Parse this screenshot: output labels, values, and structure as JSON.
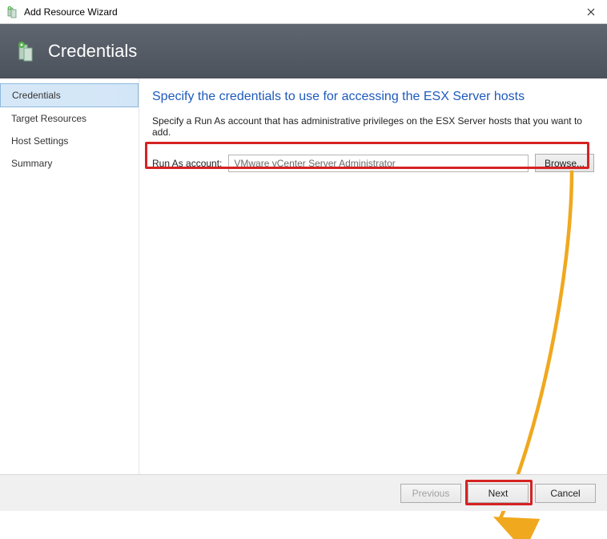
{
  "titlebar": {
    "title": "Add Resource Wizard"
  },
  "header": {
    "title": "Credentials"
  },
  "sidebar": {
    "items": [
      {
        "label": "Credentials",
        "selected": true
      },
      {
        "label": "Target Resources",
        "selected": false
      },
      {
        "label": "Host Settings",
        "selected": false
      },
      {
        "label": "Summary",
        "selected": false
      }
    ]
  },
  "main": {
    "heading": "Specify the credentials to use for accessing the ESX Server hosts",
    "description": "Specify a Run As account that has administrative privileges on the ESX Server hosts that you want to add.",
    "runas_label": "Run As account:",
    "runas_value": "VMware vCenter Server Administrator",
    "browse_label": "Browse..."
  },
  "footer": {
    "previous": "Previous",
    "next": "Next",
    "cancel": "Cancel"
  }
}
